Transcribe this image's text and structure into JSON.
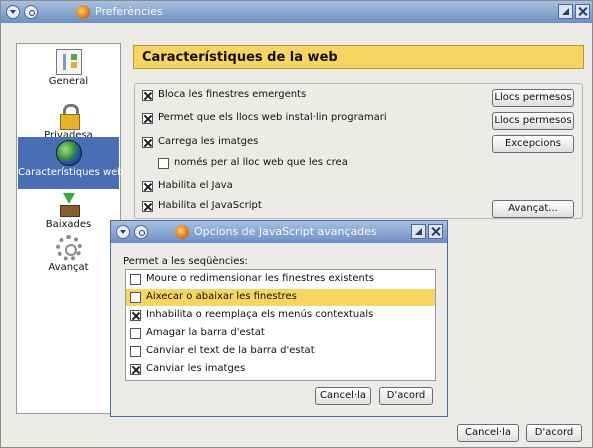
{
  "window": {
    "title": "Preferències",
    "icons": [
      "window-menu-icon",
      "window-sticky-icon",
      "firefox-logo-icon",
      "minimize-icon",
      "close-icon"
    ]
  },
  "sidebar": {
    "items": [
      {
        "label": "General",
        "icon": "general-settings-icon"
      },
      {
        "label": "Privadesa",
        "icon": "padlock-icon"
      },
      {
        "label": "Característiques web",
        "icon": "globe-icon",
        "active": true
      },
      {
        "label": "Baixades",
        "icon": "download-box-icon"
      },
      {
        "label": "Avançat",
        "icon": "gear-icon"
      }
    ]
  },
  "page": {
    "title": "Característiques de la web",
    "options": [
      {
        "label": "Bloca les finestres emergents",
        "checked": true,
        "button": "Llocs permesos"
      },
      {
        "label": "Permet que els llocs web instal·lin programari",
        "checked": true,
        "button": "Llocs permesos"
      },
      {
        "label": "Carrega les imatges",
        "checked": true,
        "button": "Excepcions"
      },
      {
        "label": "només per al lloc web que les crea",
        "checked": false
      },
      {
        "label": "Habilita el Java",
        "checked": true
      },
      {
        "label": "Habilita el JavaScript",
        "checked": true,
        "button": "Avançat..."
      }
    ]
  },
  "footer": {
    "cancel": "Cancel·la",
    "ok": "D'acord"
  },
  "dialog": {
    "title": "Opcions de JavaScript avançades",
    "message": "Permet a les seqüències:",
    "items": [
      {
        "label": "Moure o redimensionar les finestres existents",
        "checked": false
      },
      {
        "label": "Aixecar o abaixar les finestres",
        "checked": false,
        "selected": true
      },
      {
        "label": "Inhabilita o reemplaça els menús contextuals",
        "checked": true
      },
      {
        "label": "Amagar la barra d'estat",
        "checked": false
      },
      {
        "label": "Canviar el text de la barra d'estat",
        "checked": false
      },
      {
        "label": "Canviar les imatges",
        "checked": true
      }
    ],
    "cancel": "Cancel·la",
    "ok": "D'acord"
  },
  "colors": {
    "titlebar": "#7f9ccb",
    "header_highlight": "#f6d562",
    "sidebar_selected": "#4a6eb4"
  }
}
